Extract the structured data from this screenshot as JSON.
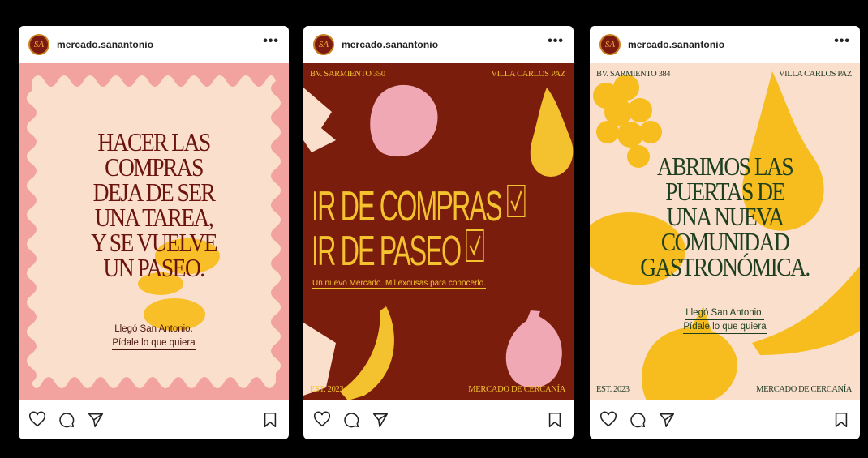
{
  "posts": [
    {
      "username": "mercado.sanantonio",
      "avatar_text": "SA",
      "more": "•••",
      "headline": [
        "HACER LAS",
        "COMPRAS",
        "DEJA DE SER",
        "UNA TAREA,",
        "Y SE VUELVE",
        "UN PASEO."
      ],
      "sub": [
        "Llegó San Antonio.",
        "Pídale lo que quiera"
      ],
      "colors": {
        "bg": "#fbdfcd",
        "border": "#f2a3a0",
        "text": "#6b140e",
        "accent": "#f8bd20"
      }
    },
    {
      "username": "mercado.sanantonio",
      "avatar_text": "SA",
      "more": "•••",
      "top_left": "BV. SARMIENTO 350",
      "top_right": "VILLA CARLOS PAZ",
      "headline": [
        "IR DE COMPRAS",
        "IR DE PASEO"
      ],
      "tagline": "Un nuevo Mercado. Mil excusas para conocerlo.",
      "bottom_left": "EST. 2023",
      "bottom_right": "MERCADO DE CERCANÍA",
      "colors": {
        "bg": "#7a1d0c",
        "yellow": "#f4c22e",
        "pink": "#f0a8b5"
      }
    },
    {
      "username": "mercado.sanantonio",
      "avatar_text": "SA",
      "more": "•••",
      "top_left": "BV. SARMIENTO 384",
      "top_right": "VILLA CARLOS PAZ",
      "headline": [
        "ABRIMOS LAS",
        "PUERTAS DE",
        "UNA NUEVA",
        "COMUNIDAD",
        "GASTRONÓMICA."
      ],
      "sub": [
        "Llegó San Antonio.",
        "Pídale lo que quiera"
      ],
      "bottom_left": "EST. 2023",
      "bottom_right": "MERCADO DE CERCANÍA",
      "colors": {
        "bg": "#fbdfcd",
        "yellow": "#f7bd1e",
        "text": "#1d3f1f"
      }
    }
  ],
  "icons": [
    "heart-icon",
    "comment-icon",
    "share-icon",
    "bookmark-icon"
  ]
}
